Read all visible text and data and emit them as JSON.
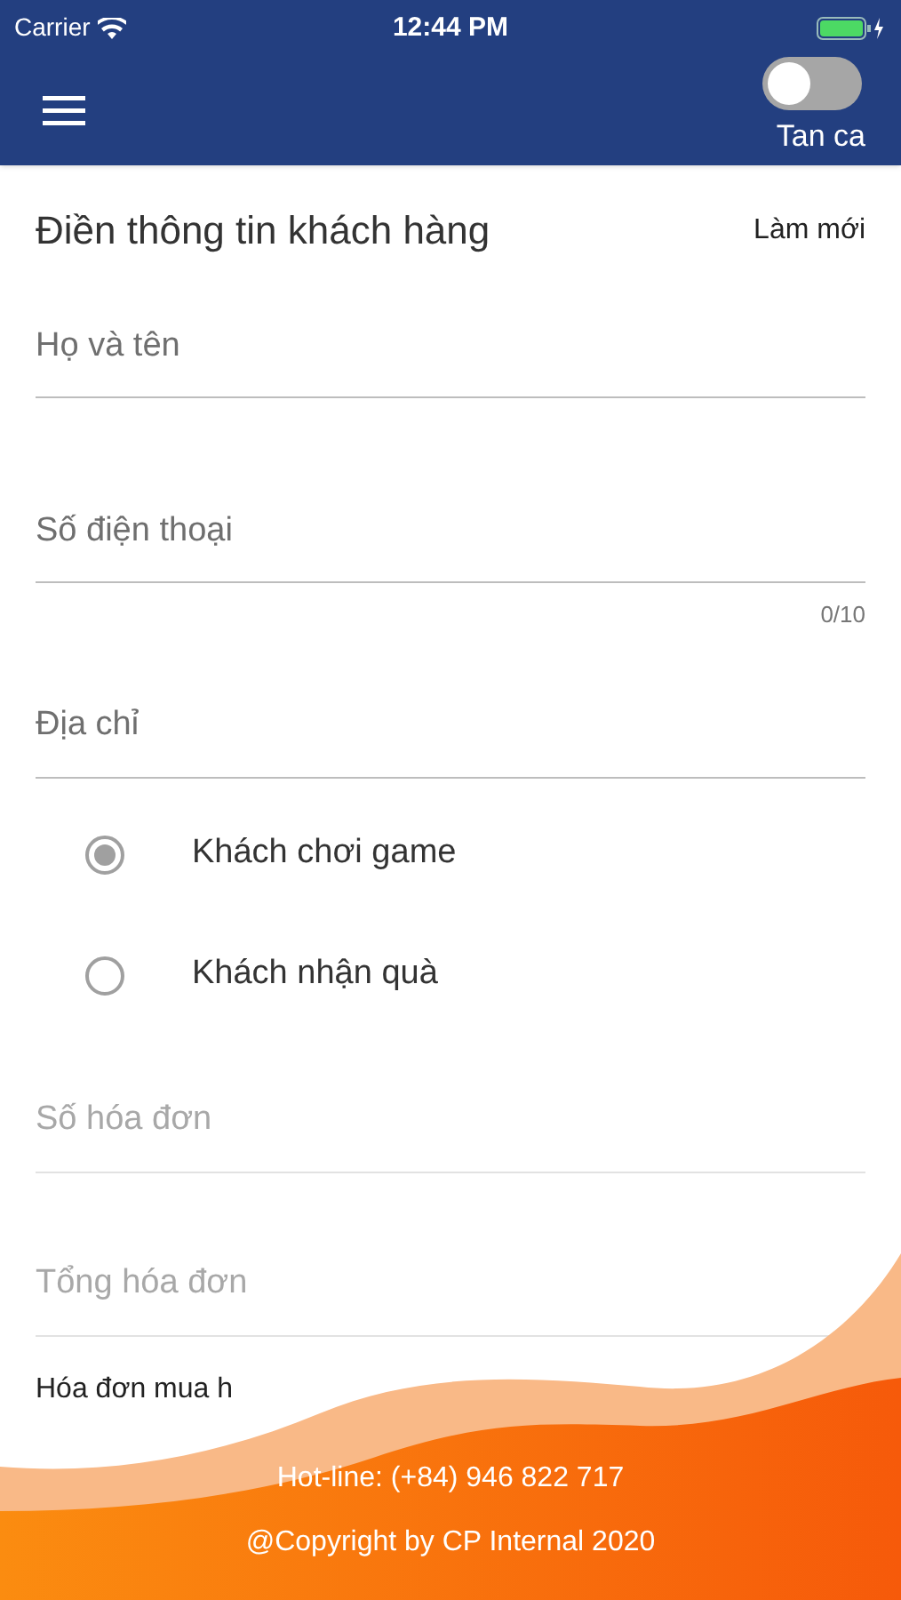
{
  "status_bar": {
    "carrier": "Carrier",
    "time": "12:44 PM"
  },
  "header": {
    "switch": {
      "label": "Tan ca",
      "on": false
    }
  },
  "title": "Điền thông tin khách hàng",
  "reset": "Làm mới",
  "fields": [
    {
      "placeholder": "Họ và tên",
      "disabled": false
    },
    {
      "placeholder": "Số điện thoại",
      "disabled": false,
      "counter": "0/10"
    },
    {
      "placeholder": "Địa chỉ",
      "disabled": false
    }
  ],
  "radios": [
    {
      "label": "Khách chơi game",
      "selected": true
    },
    {
      "label": "Khách nhận quà",
      "selected": false
    }
  ],
  "invoice_fields": [
    {
      "placeholder": "Số hóa đơn",
      "disabled": true
    },
    {
      "placeholder": "Tổng hóa đơn",
      "disabled": true
    }
  ],
  "section_label": "Hóa đơn mua h",
  "footer": {
    "hotline": "Hot-line: (+84) 946 822 717",
    "copyright": "@Copyright by CP Internal 2020"
  }
}
